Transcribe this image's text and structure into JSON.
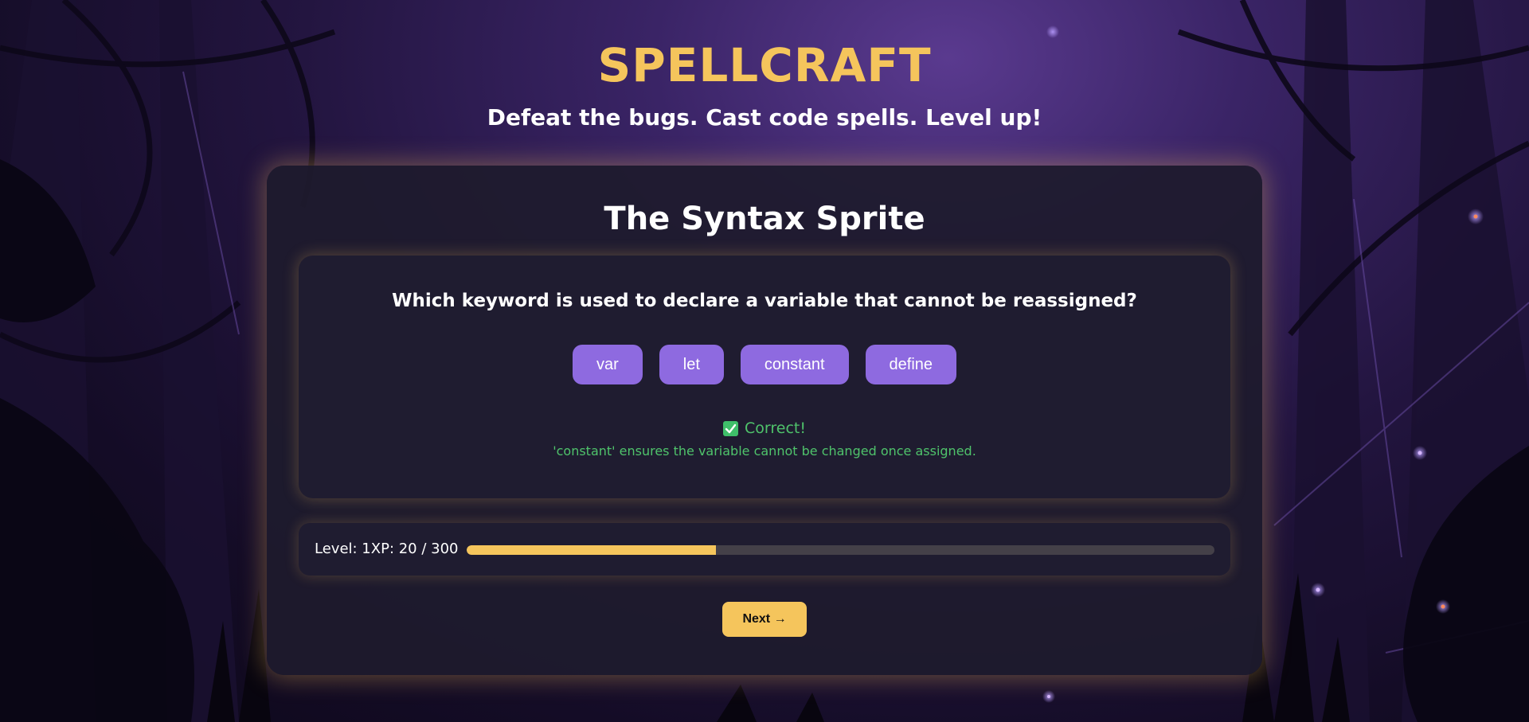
{
  "header": {
    "title": "SPELLCRAFT",
    "tagline": "Defeat the bugs. Cast code spells. Level up!"
  },
  "boss": {
    "name": "The Syntax Sprite"
  },
  "quiz": {
    "question": "Which keyword is used to declare a variable that cannot be reassigned?",
    "options": [
      "var",
      "let",
      "constant",
      "define"
    ],
    "feedback": {
      "status": "Correct!",
      "icon": "check-icon",
      "explanation": "'constant' ensures the variable cannot be changed once assigned."
    }
  },
  "progress": {
    "label": "Level: 1XP: 20 / 300",
    "fill_fraction": 0.333
  },
  "actions": {
    "next_label": "Next →"
  },
  "colors": {
    "accent_gold": "#f5c55c",
    "option_purple": "#8e6ae0",
    "success_green": "#4fc36b"
  }
}
